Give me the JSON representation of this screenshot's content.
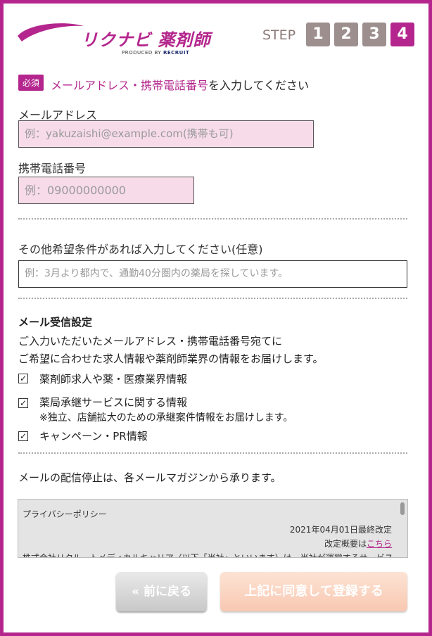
{
  "header": {
    "logo_text": "リクナビ 薬剤師",
    "logo_sub_prefix": "PRODUCED BY ",
    "logo_sub_brand": "RECRUIT",
    "step_label": "STEP",
    "steps": [
      "1",
      "2",
      "3",
      "4"
    ],
    "active_step": "4"
  },
  "contact": {
    "required_badge": "必須",
    "title_highlight": "メールアドレス・携帯電話番号",
    "title_rest": "を入力してください",
    "email_label": "メールアドレス",
    "email_placeholder": "例：yakuzaishi@example.com(携帯も可)",
    "phone_label": "携帯電話番号",
    "phone_placeholder": "例：09000000000"
  },
  "conditions": {
    "label": "その他希望条件があれば入力してください(任意)",
    "placeholder": "例：3月より都内で、通勤40分圏内の薬局を探しています。"
  },
  "mail_settings": {
    "title": "メール受信設定",
    "desc_line1": "ご入力いただいたメールアドレス・携帯電話番号宛てに",
    "desc_line2": "ご希望に合わせた求人情報や薬剤師業界の情報をお届けします。",
    "options": [
      {
        "label": "薬剤師求人や薬・医療業界情報",
        "checked": true
      },
      {
        "label": "薬局承継サービスに関する情報",
        "sub": "※独立、店舗拡大のための承継案件情報をお届けします。",
        "checked": true
      },
      {
        "label": "キャンペーン・PR情報",
        "checked": true
      }
    ],
    "check_mark": "✓"
  },
  "stop_note": "メールの配信停止は、各メールマガジンから承ります。",
  "policy": {
    "title": "プライバシーポリシー",
    "date": "2021年04月01日最終改定",
    "outline_prefix": "改定概要は",
    "outline_link": "こちら",
    "body": "株式会社リクルートメディカルキャリア（以下「当社」といいます）は、当社が運営するサービス"
  },
  "buttons": {
    "back": "« 前に戻る",
    "agree": "上記に同意して登録する"
  },
  "colors": {
    "accent": "#b4268d",
    "input_bg": "#f7dbe8",
    "step_inactive": "#9e8f8f"
  }
}
